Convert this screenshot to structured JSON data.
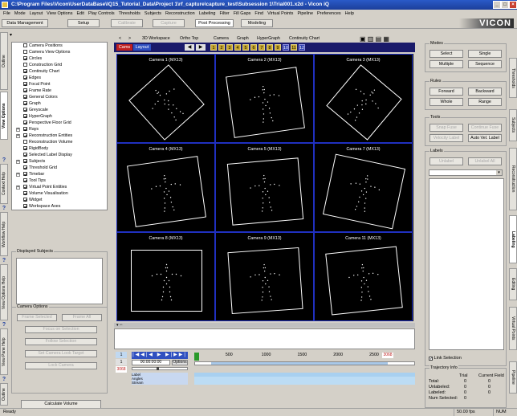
{
  "window": {
    "title": "C:\\Program Files\\Vicon\\UserDataBase\\IQ15_Tutorial_Data\\Project 1\\rf_capture\\capture_test\\Subsession 1\\Trial001.x2d - Vicon iQ"
  },
  "menu": [
    "File",
    "Mode",
    "Layout",
    "View Options",
    "Edit",
    "Play Controls",
    "Thresholds",
    "Subjects",
    "Reconstruction",
    "Labeling",
    "Filter",
    "Fill Gaps",
    "Find",
    "Virtual Points",
    "Pipeline",
    "Preferences",
    "Help"
  ],
  "toolbar": {
    "buttons": [
      "Data Management",
      "Setup",
      "Calibrate",
      "Capture",
      "Post Processing",
      "Modeling"
    ],
    "disabled": [
      false,
      false,
      true,
      true,
      false,
      false
    ],
    "logo": "VICON"
  },
  "left_tabs": [
    "Outline",
    "View Options",
    "Context Help",
    "Workflow Help",
    "View Options Help",
    "View Pane Help",
    "Outline Help"
  ],
  "view_options": {
    "items": [
      {
        "label": "Camera Positions",
        "checked": false
      },
      {
        "label": "Camera View Options",
        "checked": false
      },
      {
        "label": "Circles",
        "checked": true
      },
      {
        "label": "Construction Grid",
        "checked": false
      },
      {
        "label": "Continuity Chart",
        "checked": true
      },
      {
        "label": "Edges",
        "checked": true
      },
      {
        "label": "Focal Point",
        "checked": true
      },
      {
        "label": "Frame Rate",
        "checked": true
      },
      {
        "label": "General Colors",
        "checked": true
      },
      {
        "label": "Graph",
        "checked": true
      },
      {
        "label": "Greyscale",
        "checked": true
      },
      {
        "label": "HyperGraph",
        "checked": true
      },
      {
        "label": "Perspective Floor Grid",
        "checked": true
      },
      {
        "label": "Rays",
        "checked": true
      },
      {
        "label": "Reconstruction Entities",
        "checked": true
      },
      {
        "label": "Reconstruction Volume",
        "checked": false
      },
      {
        "label": "RigidBody",
        "checked": true
      },
      {
        "label": "Selected Label Display",
        "checked": true
      },
      {
        "label": "Subjects",
        "checked": true
      },
      {
        "label": "Threshold Grid",
        "checked": true
      },
      {
        "label": "Timebar",
        "checked": true
      },
      {
        "label": "Tool Tips",
        "checked": true
      },
      {
        "label": "Virtual Point Entities",
        "checked": true
      },
      {
        "label": "Volume Visualisation",
        "checked": true
      },
      {
        "label": "Widget",
        "checked": true
      },
      {
        "label": "Workspace Axes",
        "checked": true
      }
    ]
  },
  "displayed_subjects": {
    "title": "Displayed Subjects"
  },
  "camera_options": {
    "title": "Camera Options",
    "buttons": [
      "Frame Selected",
      "Frame All",
      "Focus on Selection",
      "Follow Selection",
      "Set Camera Look Target",
      "Lock Camera"
    ],
    "calc": "Calculate Volume"
  },
  "view_toolbar": {
    "items": [
      "<",
      ">",
      "3D Workspace",
      "Ortho Top",
      "Camera",
      "Graph",
      "HyperGraph",
      "Continuity Chart"
    ]
  },
  "camera_bar": {
    "tabs": [
      "Cams",
      "Layout"
    ],
    "numbers": [
      "1",
      "2",
      "3",
      "4",
      "5",
      "6",
      "7",
      "8",
      "9",
      "10",
      "11",
      "12"
    ]
  },
  "cameras": [
    "Camera 1 (MX13)",
    "Camera 2 (MX13)",
    "Camera 3 (MX13)",
    "Camera 4 (MX13)",
    "Camera 5 (MX13)",
    "Camera 7 (MX13)",
    "Camera 8 (MX13)",
    "Camera 9 (MX13)",
    "Camera 11 (MX13)"
  ],
  "right_panel": {
    "modes": {
      "title": "Modes",
      "buttons": [
        "Select",
        "Single",
        "Multiple",
        "Sequence"
      ]
    },
    "rules": {
      "title": "Rules",
      "buttons": [
        "Forward",
        "Backward",
        "Whole",
        "Range"
      ]
    },
    "tools": {
      "title": "Tools",
      "buttons": [
        "Snap Fuse",
        "Continue Fuse",
        "Velocity Label",
        "Auto Vel. Label"
      ]
    },
    "labels": {
      "title": "Labels",
      "buttons": [
        "Unlabel",
        "Unlabel All"
      ],
      "link_selection": "Link Selection"
    },
    "trajectory": {
      "title": "Trajectory Info",
      "col1": "Trial",
      "col2": "Current Field",
      "rows": [
        [
          "Total:",
          "0",
          "0"
        ],
        [
          "Unlabeled:",
          "0",
          "0"
        ],
        [
          "Labeled:",
          "0",
          "0"
        ],
        [
          "Num Selected:",
          "0",
          ""
        ]
      ]
    }
  },
  "right_tabs": [
    "Thresholds",
    "Subjects",
    "Reconstruction",
    "Labeling",
    "Editing",
    "Virtual Points",
    "Pipeline"
  ],
  "timeline": {
    "frame_start": "1",
    "frame_cur": "1",
    "frame_end": "3068",
    "timecode": "00:00:00:00",
    "speed_label": "Options",
    "ticks": [
      "500",
      "1000",
      "1500",
      "2000",
      "2500"
    ],
    "end_label": "3068",
    "track_labels": [
      "Label",
      "Angles",
      "Stream"
    ]
  },
  "status": {
    "left": "Ready",
    "rate": "50.00 fps",
    "num": "NUM"
  }
}
